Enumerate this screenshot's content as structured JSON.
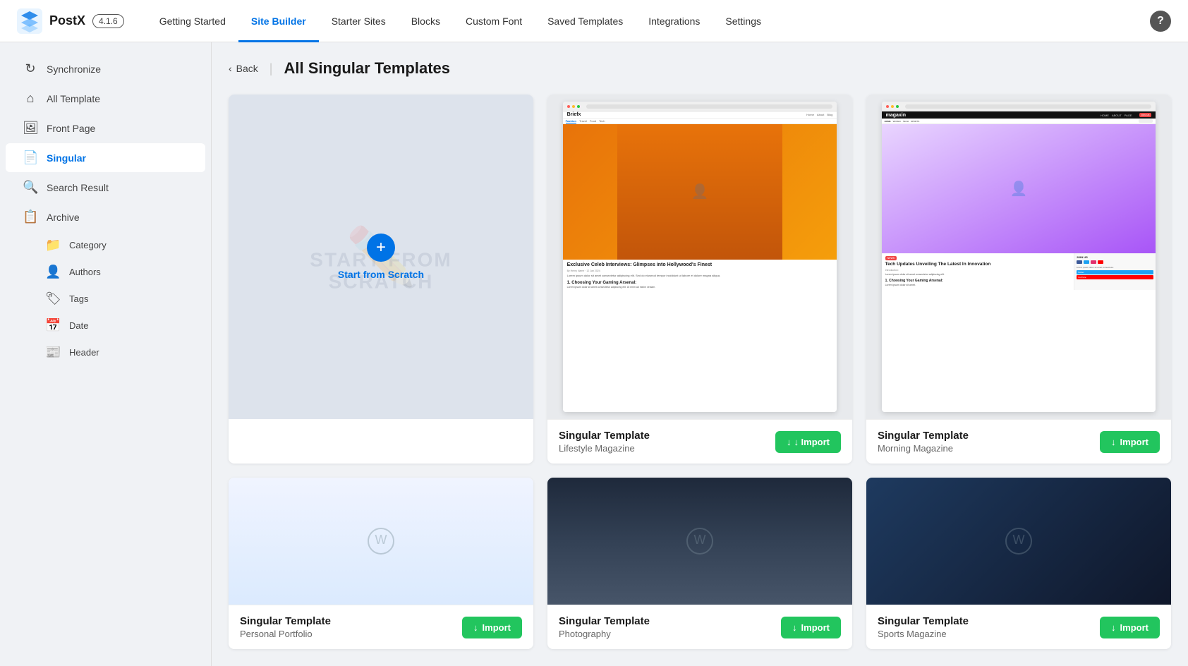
{
  "app": {
    "logo_text": "PostX",
    "version": "4.1.6"
  },
  "nav": {
    "links": [
      {
        "label": "Getting Started",
        "active": false
      },
      {
        "label": "Site Builder",
        "active": true
      },
      {
        "label": "Starter Sites",
        "active": false
      },
      {
        "label": "Blocks",
        "active": false
      },
      {
        "label": "Custom Font",
        "active": false
      },
      {
        "label": "Saved Templates",
        "active": false
      },
      {
        "label": "Integrations",
        "active": false
      },
      {
        "label": "Settings",
        "active": false
      }
    ],
    "help_label": "?"
  },
  "sidebar": {
    "items": [
      {
        "label": "Synchronize",
        "icon": "🔄",
        "active": false,
        "id": "synchronize"
      },
      {
        "label": "All Template",
        "icon": "🏠",
        "active": false,
        "id": "all-template"
      },
      {
        "label": "Front Page",
        "icon": "🖼",
        "active": false,
        "id": "front-page"
      },
      {
        "label": "Singular",
        "icon": "📄",
        "active": true,
        "id": "singular"
      },
      {
        "label": "Search Result",
        "icon": "🔍",
        "active": false,
        "id": "search-result"
      },
      {
        "label": "Archive",
        "icon": "📋",
        "active": false,
        "id": "archive"
      }
    ],
    "sub_items": [
      {
        "label": "Category",
        "icon": "📁",
        "id": "category"
      },
      {
        "label": "Authors",
        "icon": "👤",
        "id": "authors"
      },
      {
        "label": "Tags",
        "icon": "🏷",
        "id": "tags"
      },
      {
        "label": "Date",
        "icon": "📅",
        "id": "date"
      },
      {
        "label": "Header",
        "icon": "📰",
        "id": "header"
      }
    ]
  },
  "page": {
    "back_label": "Back",
    "title": "All Singular Templates"
  },
  "templates": {
    "scratch": {
      "label": "Start from Scratch",
      "bg_text": "START FROM SCRATCH"
    },
    "cards": [
      {
        "id": "lifestyle",
        "name": "Singular Template",
        "sub": "Lifestyle Magazine",
        "import_label": "↓ Import",
        "row": 0
      },
      {
        "id": "morning",
        "name": "Singular Template",
        "sub": "Morning Magazine",
        "import_label": "↓ Import",
        "row": 0
      },
      {
        "id": "portfolio",
        "name": "Singular Template",
        "sub": "Personal Portfolio",
        "import_label": "↓ Import",
        "row": 1
      },
      {
        "id": "photography",
        "name": "Singular Template",
        "sub": "Photography",
        "import_label": "↓ Import",
        "row": 1
      },
      {
        "id": "sports",
        "name": "Singular Template",
        "sub": "Sports Magazine",
        "import_label": "↓ Import",
        "row": 1
      }
    ]
  },
  "colors": {
    "primary": "#0073e6",
    "import_green": "#22c55e",
    "active_blue": "#0073e6"
  }
}
